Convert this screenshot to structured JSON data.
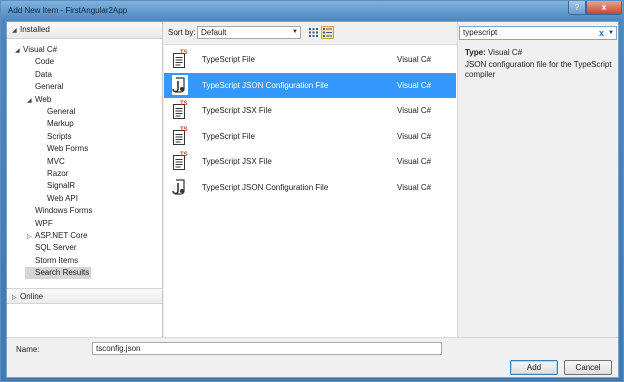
{
  "window": {
    "title": "Add New Item - FirstAngular2App",
    "help_label": "?",
    "close_label": "x"
  },
  "tree": {
    "installed_label": "Installed",
    "items": [
      {
        "label": "Visual C#",
        "arrow": "◢"
      },
      {
        "label": "Code"
      },
      {
        "label": "Data"
      },
      {
        "label": "General"
      },
      {
        "label": "Web",
        "arrow": "◢"
      },
      {
        "label": "General"
      },
      {
        "label": "Markup"
      },
      {
        "label": "Scripts"
      },
      {
        "label": "Web Forms"
      },
      {
        "label": "MVC"
      },
      {
        "label": "Razor"
      },
      {
        "label": "SignalR"
      },
      {
        "label": "Web API"
      },
      {
        "label": "Windows Forms"
      },
      {
        "label": "WPF"
      },
      {
        "label": "ASP.NET Core",
        "arrow": "▷"
      },
      {
        "label": "SQL Server"
      },
      {
        "label": "Storm Items"
      },
      {
        "label": "Search Results"
      }
    ],
    "online_label": "Online"
  },
  "toolbar": {
    "sort_label": "Sort by:",
    "sort_value": "Default"
  },
  "templates": [
    {
      "name": "TypeScript File",
      "type": "Visual C#",
      "icon": "typescript-file-icon"
    },
    {
      "name": "TypeScript JSON Configuration File",
      "type": "Visual C#",
      "icon": "json-config-icon",
      "selected": true
    },
    {
      "name": "TypeScript JSX File",
      "type": "Visual C#",
      "icon": "typescript-file-icon"
    },
    {
      "name": "TypeScript File",
      "type": "Visual C#",
      "icon": "typescript-file-icon"
    },
    {
      "name": "TypeScript JSX File",
      "type": "Visual C#",
      "icon": "typescript-file-icon"
    },
    {
      "name": "TypeScript JSON Configuration File",
      "type": "Visual C#",
      "icon": "json-config-icon"
    }
  ],
  "search": {
    "value": "typescript",
    "clear_label": "x"
  },
  "info": {
    "type_label": "Type:",
    "type_value": "Visual C#",
    "description": "JSON configuration file for the TypeScript compiler"
  },
  "footer": {
    "name_label": "Name:",
    "name_value": "tsconfig.json",
    "add_label": "Add",
    "cancel_label": "Cancel"
  },
  "colors": {
    "selection": "#3399ff",
    "title_gradient": "#4a86bf",
    "ts_badge": "#c7452d"
  }
}
